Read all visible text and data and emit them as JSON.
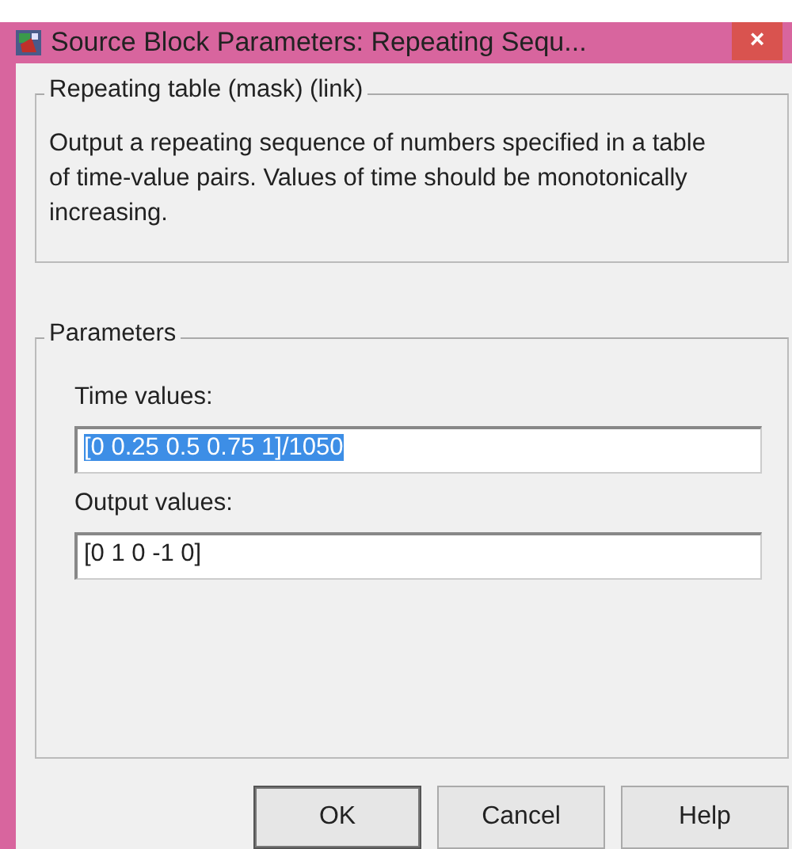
{
  "window": {
    "title": "Source Block Parameters: Repeating Sequ...",
    "close": "×"
  },
  "description_group": {
    "title": "Repeating table (mask) (link)",
    "text": "Output a repeating sequence of numbers specified in a table of time-value pairs. Values of time should be monotonically increasing."
  },
  "parameters_group": {
    "title": "Parameters",
    "fields": [
      {
        "label": "Time values:",
        "value": "[0 0.25 0.5 0.75 1]/1050",
        "text_selected": true
      },
      {
        "label": "Output values:",
        "value": "[0 1 0 -1 0]",
        "text_selected": false
      }
    ]
  },
  "buttons": [
    {
      "label": "OK",
      "default": true
    },
    {
      "label": "Cancel",
      "default": false
    },
    {
      "label": "Help",
      "default": false
    }
  ]
}
